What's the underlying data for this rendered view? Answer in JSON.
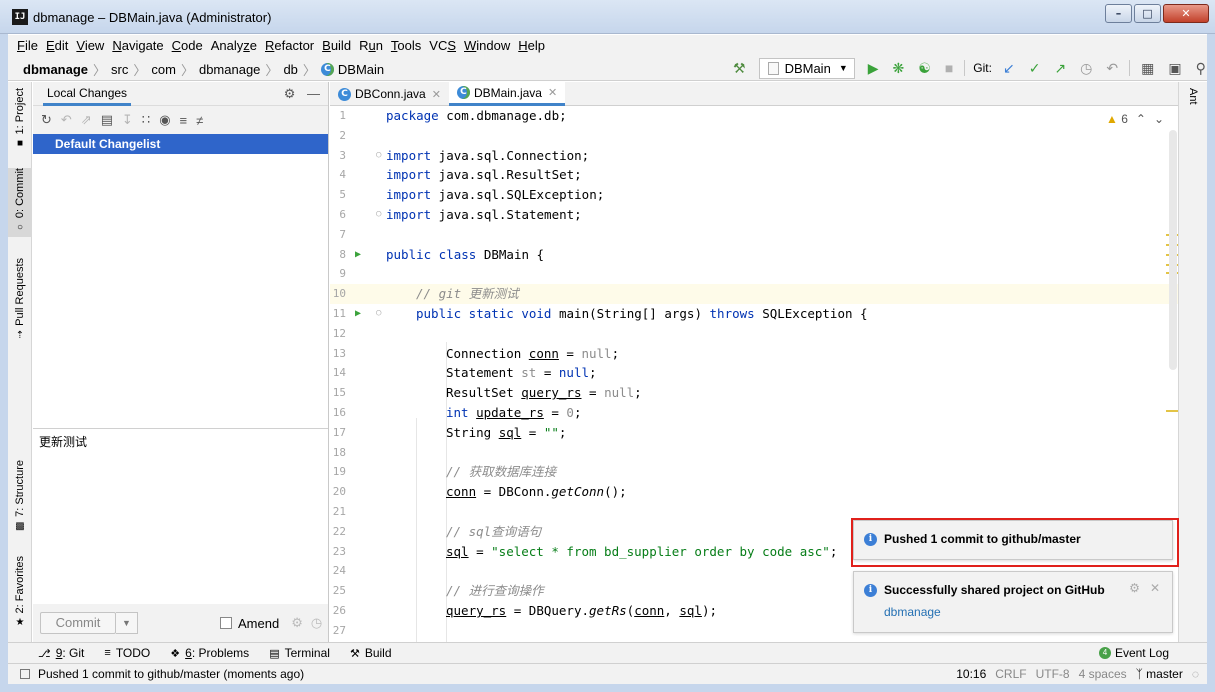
{
  "window": {
    "title": "dbmanage – DBMain.java (Administrator)",
    "app_icon": "IJ",
    "buttons": [
      "minimize",
      "maximize",
      "close"
    ]
  },
  "menu": [
    {
      "label": "File",
      "mn": "F",
      "rest": "ile"
    },
    {
      "label": "Edit",
      "mn": "E",
      "rest": "dit"
    },
    {
      "label": "View",
      "mn": "V",
      "rest": "iew"
    },
    {
      "label": "Navigate",
      "mn": "N",
      "rest": "avigate"
    },
    {
      "label": "Code",
      "mn": "C",
      "rest": "ode"
    },
    {
      "label": "Analyze",
      "pre": "Analy",
      "mn": "z",
      "rest": "e"
    },
    {
      "label": "Refactor",
      "mn": "R",
      "rest": "efactor"
    },
    {
      "label": "Build",
      "mn": "B",
      "rest": "uild"
    },
    {
      "label": "Run",
      "pre": "R",
      "mn": "u",
      "rest": "n"
    },
    {
      "label": "Tools",
      "mn": "T",
      "rest": "ools"
    },
    {
      "label": "VCS",
      "pre": "VC",
      "mn": "S",
      "rest": ""
    },
    {
      "label": "Window",
      "mn": "W",
      "rest": "indow"
    },
    {
      "label": "Help",
      "mn": "H",
      "rest": "elp"
    }
  ],
  "breadcrumb": {
    "project": "dbmanage",
    "parts": [
      "src",
      "com",
      "dbmanage",
      "db"
    ],
    "file": "DBMain"
  },
  "run_config": "DBMain",
  "vcs_label": "Git:",
  "left_stripe": {
    "project": "1: Project",
    "commit": "0: Commit",
    "pull_requests": "Pull Requests",
    "structure": "7: Structure",
    "favorites": "2: Favorites"
  },
  "commit_panel": {
    "tab": "Local Changes",
    "changelist": "Default Changelist",
    "message": "更新测试",
    "commit_button": "Commit",
    "amend_label": "Amend"
  },
  "editor": {
    "tabs": [
      {
        "label": "DBConn.java",
        "active": false
      },
      {
        "label": "DBMain.java",
        "active": true
      }
    ],
    "warnings": "6",
    "lines": [
      "1",
      "2",
      "3",
      "4",
      "5",
      "6",
      "7",
      "8",
      "9",
      "10",
      "11",
      "12",
      "13",
      "14",
      "15",
      "16",
      "17",
      "18",
      "19",
      "20",
      "21",
      "22",
      "23",
      "24",
      "25",
      "26",
      "27"
    ],
    "code": {
      "l1a": "package",
      "l1b": " com.dbmanage.db;",
      "l3a": "import",
      "l3b": " java.sql.Connection;",
      "l4a": "import",
      "l4b": " java.sql.ResultSet;",
      "l5a": "import",
      "l5b": " java.sql.SQLException;",
      "l6a": "import",
      "l6b": " java.sql.Statement;",
      "l8a": "public class",
      "l8b": " DBMain {",
      "l10": "// git 更新测试",
      "l11a": "public static void",
      "l11b": " main(String[] args) ",
      "l11c": "throws",
      "l11d": " SQLException {",
      "l13a": "Connection ",
      "l13b": "conn",
      "l13c": " = ",
      "l13d": "null",
      "l13e": ";",
      "l14a": "Statement ",
      "l14b": "st",
      "l14c": " = ",
      "l14d": "null",
      "l14e": ";",
      "l15a": "ResultSet ",
      "l15b": "query_rs",
      "l15c": " = ",
      "l15d": "null",
      "l15e": ";",
      "l16a": "int",
      "l16b": " ",
      "l16c": "update_rs",
      "l16d": " = ",
      "l16e": "0",
      "l16f": ";",
      "l17a": "String ",
      "l17b": "sql",
      "l17c": " = ",
      "l17d": "\"\"",
      "l17e": ";",
      "l19": "// 获取数据库连接",
      "l20a": "conn",
      "l20b": " = DBConn.",
      "l20c": "getConn",
      "l20d": "();",
      "l22": "// sql查询语句",
      "l23a": "sql",
      "l23b": " = ",
      "l23c": "\"select * from bd_supplier order by code asc\"",
      "l23d": ";",
      "l25": "// 进行查询操作",
      "l26a": "query_rs",
      "l26b": " = DBQuery.",
      "l26c": "getRs",
      "l26d": "(",
      "l26e": "conn",
      "l26f": ", ",
      "l26g": "sql",
      "l26h": ");"
    }
  },
  "right_stripe": "Ant",
  "notifications": [
    {
      "title": "Pushed 1 commit to github/master"
    },
    {
      "title": "Successfully shared project on GitHub",
      "link": "dbmanage"
    }
  ],
  "bottom_tools": [
    {
      "mn": "9",
      "label": ": Git",
      "icon": "git-icon"
    },
    {
      "mn": "",
      "label": "TODO",
      "icon": "todo-icon"
    },
    {
      "mn": "6",
      "label": ": Problems",
      "icon": "problems-icon"
    },
    {
      "mn": "",
      "label": "Terminal",
      "icon": "terminal-icon"
    },
    {
      "mn": "",
      "label": "Build",
      "icon": "build-icon"
    }
  ],
  "event_log": "Event Log",
  "event_count": "4",
  "status": {
    "message": "Pushed 1 commit to github/master (moments ago)",
    "position": "10:16",
    "line_sep": "CRLF",
    "encoding": "UTF-8",
    "indent": "4 spaces",
    "branch": "master"
  }
}
